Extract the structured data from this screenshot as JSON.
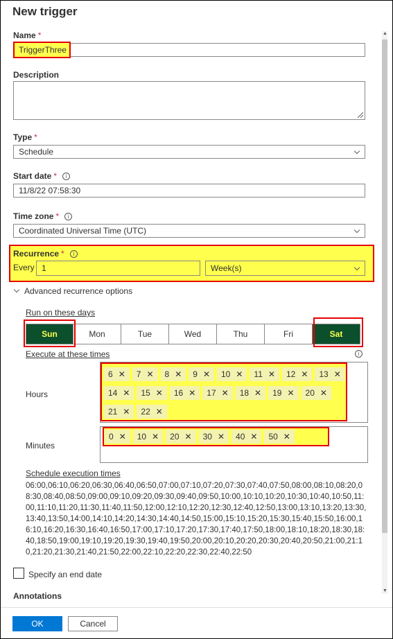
{
  "dialog": {
    "title": "New trigger"
  },
  "name": {
    "label": "Name",
    "required": "*",
    "value": "TriggerThree"
  },
  "description": {
    "label": "Description",
    "value": ""
  },
  "type": {
    "label": "Type",
    "required": "*",
    "value": "Schedule"
  },
  "start_date": {
    "label": "Start date",
    "required": "*",
    "value": "11/8/22 07:58:30"
  },
  "time_zone": {
    "label": "Time zone",
    "required": "*",
    "value": "Coordinated Universal Time (UTC)"
  },
  "recurrence": {
    "label": "Recurrence",
    "required": "*",
    "every_label": "Every",
    "interval": "1",
    "unit": "Week(s)"
  },
  "advanced": {
    "label": "Advanced recurrence options"
  },
  "days": {
    "label": "Run on these days",
    "items": [
      {
        "label": "Sun",
        "selected": true
      },
      {
        "label": "Mon",
        "selected": false
      },
      {
        "label": "Tue",
        "selected": false
      },
      {
        "label": "Wed",
        "selected": false
      },
      {
        "label": "Thu",
        "selected": false
      },
      {
        "label": "Fri",
        "selected": false
      },
      {
        "label": "Sat",
        "selected": true
      }
    ]
  },
  "execute": {
    "label": "Execute at these times"
  },
  "hours": {
    "label": "Hours",
    "values": [
      "6",
      "7",
      "8",
      "9",
      "10",
      "11",
      "12",
      "13",
      "14",
      "15",
      "16",
      "17",
      "18",
      "19",
      "20",
      "21",
      "22"
    ]
  },
  "minutes": {
    "label": "Minutes",
    "values": [
      "0",
      "10",
      "20",
      "30",
      "40",
      "50"
    ]
  },
  "schedule": {
    "label": "Schedule execution times",
    "text": "06:00,06:10,06:20,06:30,06:40,06:50,07:00,07:10,07:20,07:30,07:40,07:50,08:00,08:10,08:20,08:30,08:40,08:50,09:00,09:10,09:20,09:30,09:40,09:50,10:00,10:10,10:20,10:30,10:40,10:50,11:00,11:10,11:20,11:30,11:40,11:50,12:00,12:10,12:20,12:30,12:40,12:50,13:00,13:10,13:20,13:30,13:40,13:50,14:00,14:10,14:20,14:30,14:40,14:50,15:00,15:10,15:20,15:30,15:40,15:50,16:00,16:10,16:20,16:30,16:40,16:50,17:00,17:10,17:20,17:30,17:40,17:50,18:00,18:10,18:20,18:30,18:40,18:50,19:00,19:10,19:20,19:30,19:40,19:50,20:00,20:10,20:20,20:30,20:40,20:50,21:00,21:10,21:20,21:30,21:40,21:50,22:00,22:10,22:20,22:30,22:40,22:50"
  },
  "end_date": {
    "label": "Specify an end date",
    "checked": false
  },
  "annotations": {
    "label": "Annotations"
  },
  "footer": {
    "ok_label": "OK",
    "cancel_label": "Cancel"
  },
  "colors": {
    "accent": "#0078d4",
    "selected_day": "#0b4f2d",
    "highlight": "#ffff4d",
    "annotation": "#e60000"
  },
  "icons": {
    "info": "info-icon",
    "dropdown": "chevron-down-icon",
    "expand": "chevron-down-icon",
    "remove": "close-icon"
  }
}
